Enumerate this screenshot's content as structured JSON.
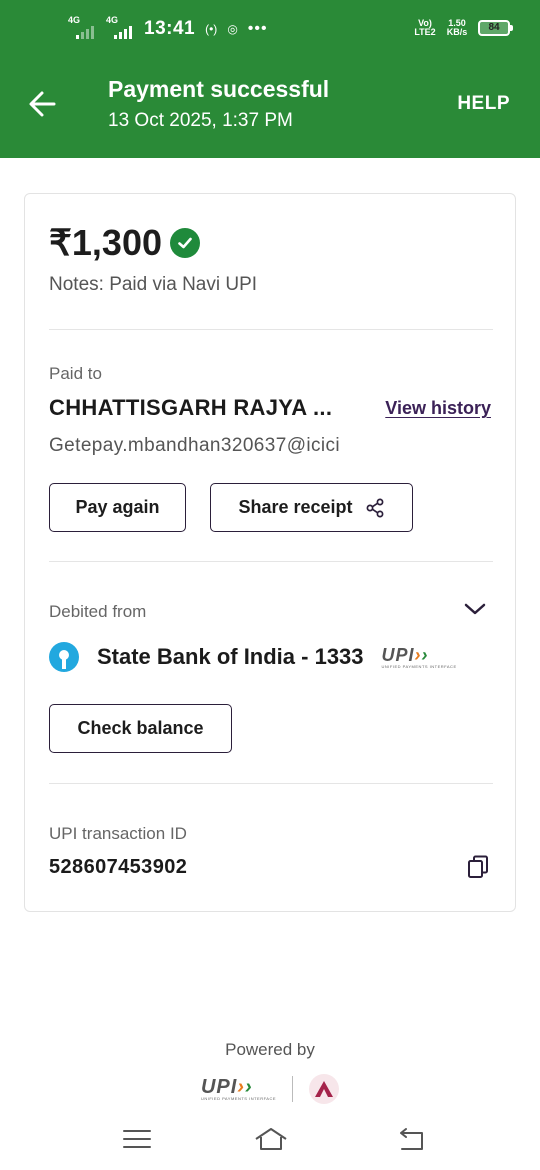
{
  "status_bar": {
    "net1": "4G",
    "net2": "4G",
    "time": "13:41",
    "volte": "Vo) LTE2",
    "speed": "1.50 KB/s",
    "battery": "84"
  },
  "header": {
    "title": "Payment successful",
    "datetime": "13 Oct 2025, 1:37 PM",
    "help": "HELP",
    "bg_color": "#2a8a37"
  },
  "payment": {
    "amount": "₹1,300",
    "notes": "Notes: Paid via Navi UPI"
  },
  "paid_to": {
    "label": "Paid to",
    "name": "CHHATTISGARH RAJYA ...",
    "view_history": "View history",
    "vpa": "Getepay.mbandhan320637@icici",
    "pay_again": "Pay again",
    "share_receipt": "Share receipt"
  },
  "debit": {
    "label": "Debited from",
    "bank": "State Bank of India - 1333",
    "upi_word": "UPI",
    "upi_tagline": "UNIFIED PAYMENTS INTERFACE",
    "check_balance": "Check balance"
  },
  "transaction": {
    "label": "UPI transaction ID",
    "id": "528607453902"
  },
  "footer": {
    "powered_by": "Powered by",
    "upi_word": "UPI",
    "upi_tagline": "UNIFIED PAYMENTS INTERFACE"
  },
  "icons": {
    "back": "arrow-left-icon",
    "check": "check-circle-icon",
    "share": "share-icon",
    "chevron": "chevron-down-icon",
    "bank": "sbi-logo-icon",
    "copy": "copy-icon",
    "partner": "axis-bank-logo-icon",
    "menu": "menu-icon",
    "home": "home-icon",
    "back_nav": "back-nav-icon"
  }
}
